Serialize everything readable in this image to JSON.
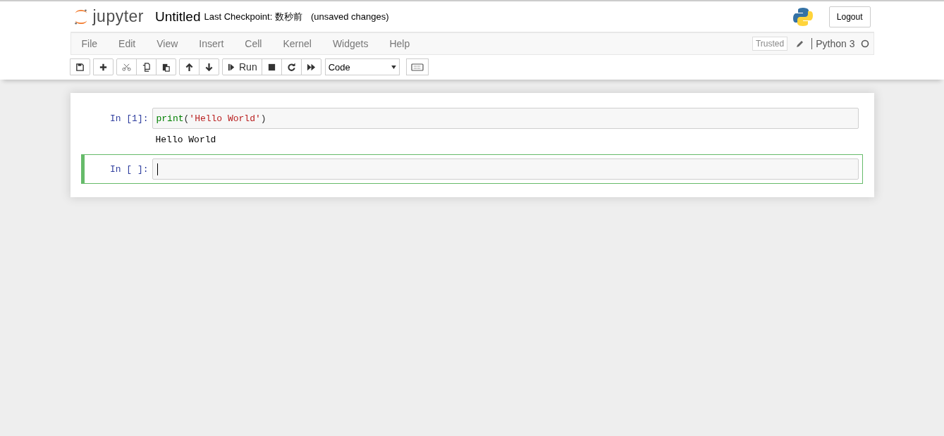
{
  "header": {
    "logo_text": "jupyter",
    "notebook_name": "Untitled",
    "checkpoint": "Last Checkpoint: 数秒前",
    "autosave_status": "(unsaved changes)",
    "logout": "Logout"
  },
  "menu": [
    "File",
    "Edit",
    "View",
    "Insert",
    "Cell",
    "Kernel",
    "Widgets",
    "Help"
  ],
  "trusted": "Trusted",
  "kernel_name": "Python 3",
  "kernel_busy": false,
  "toolbar": [
    [
      {
        "kind": "save"
      }
    ],
    [
      {
        "kind": "insert"
      }
    ],
    [
      {
        "kind": "cut"
      },
      {
        "kind": "copy"
      },
      {
        "kind": "paste"
      }
    ],
    [
      {
        "kind": "up"
      },
      {
        "kind": "down"
      }
    ],
    [
      {
        "kind": "run",
        "label": "Run"
      },
      {
        "kind": "stop"
      },
      {
        "kind": "restart"
      },
      {
        "kind": "fastforward"
      }
    ]
  ],
  "cell_type": "Code",
  "cells": [
    {
      "prompt": "In [1]:",
      "selected": false,
      "code": [
        {
          "kind": "builtin",
          "text": "print"
        },
        {
          "kind": "bracket",
          "text": "("
        },
        {
          "kind": "string",
          "text": "'Hello World'"
        },
        {
          "kind": "bracket",
          "text": ")"
        }
      ],
      "output": "Hello World"
    },
    {
      "prompt": "In [ ]:",
      "selected": true
    }
  ]
}
